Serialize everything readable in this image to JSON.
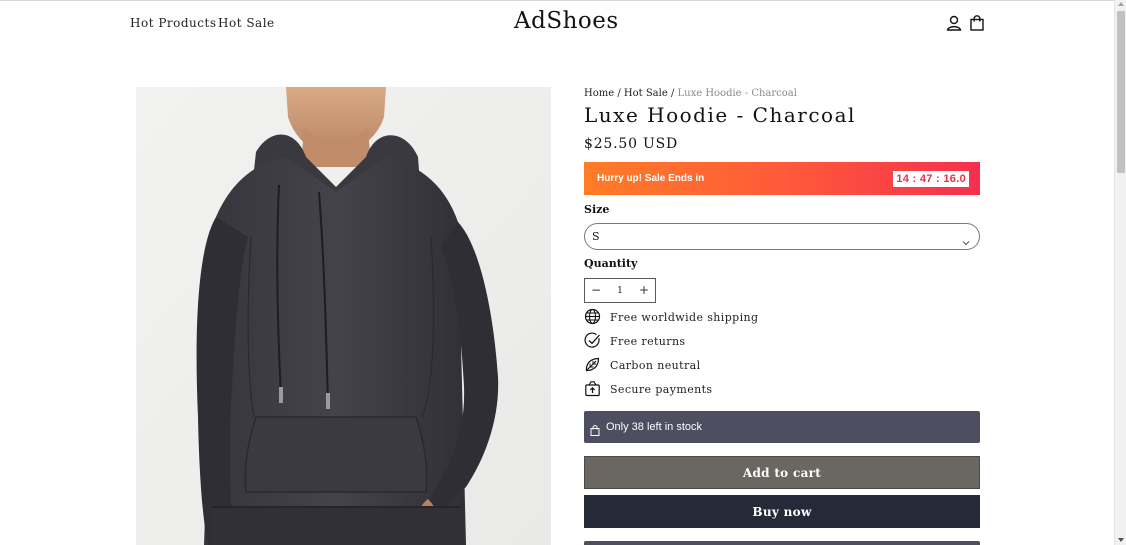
{
  "header": {
    "nav": [
      "Hot Products",
      "Hot Sale"
    ],
    "logo": "AdShoes",
    "icons": [
      "account-icon",
      "cart-bag-icon"
    ]
  },
  "breadcrumb": {
    "home": "Home",
    "sep1": " / ",
    "category": "Hot Sale",
    "sep2": " / ",
    "current": "Luxe Hoodie - Charcoal"
  },
  "product": {
    "title": "Luxe Hoodie - Charcoal",
    "price": "$25.50 USD",
    "image_icon": "hoodie-photo"
  },
  "sale": {
    "text": "Hurry up! Sale Ends in",
    "timer": "14 : 47 : 16.0",
    "colors": {
      "start": "#ff7c26",
      "end": "#f5304e",
      "timer_text": "#ec2d48"
    }
  },
  "size": {
    "label": "Size",
    "value": "S"
  },
  "quantity": {
    "label": "Quantity",
    "value": "1",
    "minus": "−",
    "plus": "+"
  },
  "features": [
    {
      "icon": "globe-icon",
      "text": "Free worldwide shipping"
    },
    {
      "icon": "check-circle-icon",
      "text": "Free returns"
    },
    {
      "icon": "leaf-icon",
      "text": "Carbon neutral"
    },
    {
      "icon": "secure-box-icon",
      "text": "Secure payments"
    }
  ],
  "stock": {
    "icon": "bag-icon",
    "text": "Only 38 left in stock",
    "color": "#4d4e5f"
  },
  "buttons": {
    "add_to_cart": "Add to cart",
    "buy_now": "Buy now",
    "cart_color": "#6a6661",
    "buy_color": "#262a38"
  }
}
